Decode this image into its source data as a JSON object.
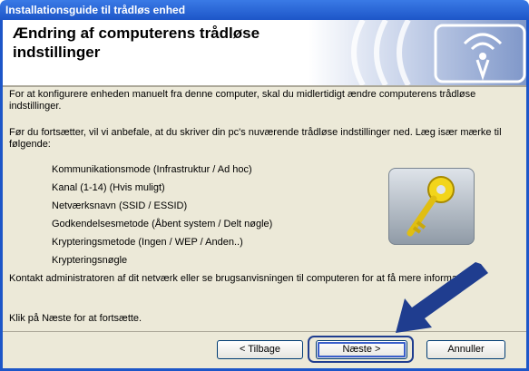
{
  "window": {
    "title": "Installationsguide til trådløs enhed"
  },
  "header": {
    "title": "Ændring af computerens trådløse indstillinger"
  },
  "content": {
    "intro": "For at konfigurere enheden manuelt fra denne computer, skal du midlertidigt ændre computerens trådløse indstillinger.",
    "instruction": "Før du fortsætter, vil vi anbefale, at du skriver din pc's nuværende trådløse indstillinger ned. Læg især mærke til følgende:",
    "items": [
      "Kommunikationsmode (Infrastruktur / Ad hoc)",
      "Kanal (1-14) (Hvis muligt)",
      "Netværksnavn (SSID / ESSID)",
      "Godkendelsesmetode (Åbent system / Delt nøgle)",
      "Krypteringsmetode (Ingen / WEP / Anden..)",
      "Krypteringsnøgle"
    ],
    "contact": "Kontakt administratoren af dit netværk eller se brugsanvisningen til computeren for at få mere information.",
    "next_hint": "Klik på Næste for at fortsætte."
  },
  "buttons": {
    "back": "< Tilbage",
    "next": "Næste >",
    "cancel": "Annuller"
  },
  "colors": {
    "titlebar": "#1d56c8",
    "highlight_arrow": "#1f3d8f"
  },
  "icons": {
    "header": "wireless-signal-icon",
    "illustration": "key-icon"
  }
}
